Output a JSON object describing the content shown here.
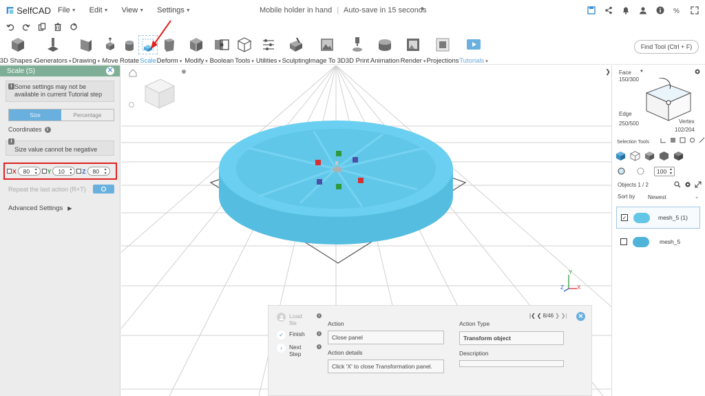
{
  "app": {
    "name": "SelfCAD"
  },
  "menu": [
    {
      "label": "File"
    },
    {
      "label": "Edit"
    },
    {
      "label": "View"
    },
    {
      "label": "Settings"
    }
  ],
  "project": {
    "title": "Mobile holder in hand",
    "autosave": "Auto-save in 15 seconds"
  },
  "toolbar": {
    "tools": [
      {
        "label": "3D Shapes",
        "has_caret": true,
        "icon": "cube-icon"
      },
      {
        "label": "Generators",
        "has_caret": true,
        "icon": "generator-icon"
      },
      {
        "label": "Drawing",
        "has_caret": true,
        "icon": "drawing-icon"
      },
      {
        "label": "Move",
        "has_caret": false,
        "icon": "move-icon"
      },
      {
        "label": "Rotate",
        "has_caret": false,
        "icon": "rotate-icon"
      },
      {
        "label": "Scale",
        "has_caret": false,
        "icon": "scale-icon",
        "active": true
      },
      {
        "label": "Deform",
        "has_caret": true,
        "icon": "deform-icon"
      },
      {
        "label": "Modify",
        "has_caret": true,
        "icon": "modify-icon"
      },
      {
        "label": "Boolean",
        "has_caret": false,
        "icon": "boolean-icon"
      },
      {
        "label": "Tools",
        "has_caret": true,
        "icon": "tools-icon"
      },
      {
        "label": "Utilities",
        "has_caret": true,
        "icon": "utilities-icon"
      },
      {
        "label": "Sculpting",
        "has_caret": false,
        "icon": "sculpting-icon"
      },
      {
        "label": "Image To 3D",
        "has_caret": false,
        "icon": "image-to-3d-icon"
      },
      {
        "label": "3D Print",
        "has_caret": false,
        "icon": "3d-print-icon"
      },
      {
        "label": "Animation",
        "has_caret": false,
        "icon": "animation-icon"
      },
      {
        "label": "Render",
        "has_caret": true,
        "icon": "render-icon"
      },
      {
        "label": "Projections",
        "has_caret": false,
        "icon": "projections-icon"
      },
      {
        "label": "Tutorials",
        "has_caret": true,
        "icon": "tutorials-icon"
      }
    ],
    "find_tool": "Find Tool (Ctrl + F)"
  },
  "left_panel": {
    "title": "Scale (S)",
    "warning": "Some settings may not be available in current Tutorial step",
    "mode_tabs": [
      "Size",
      "Percentage"
    ],
    "coordinates_label": "Coordinates",
    "size_note": "Size value cannot be negative",
    "axes": [
      {
        "label": "X",
        "value": "80",
        "color": "#d83030"
      },
      {
        "label": "Y",
        "value": "10",
        "color": "#2e9a3a"
      },
      {
        "label": "Z",
        "value": "80",
        "color": "#2b5fc7"
      }
    ],
    "repeat_label": "Repeat the last action (R+T)",
    "advanced_label": "Advanced Settings"
  },
  "right_panel": {
    "face_label": "Face",
    "face_count": "150/300",
    "edge_label": "Edge",
    "edge_count": "250/500",
    "vertex_label": "Vertex",
    "vertex_count": "102/204",
    "selection_tools_label": "Selection Tools",
    "brush_size": "100",
    "objects_label": "Objects 1 / 2",
    "sort_label": "Sort by",
    "sort_value": "Newest",
    "objects": [
      {
        "name": "mesh_5 (1)",
        "checked": true
      },
      {
        "name": "mesh_5",
        "checked": false
      }
    ]
  },
  "viewport": {
    "axes": [
      "Y",
      "Z",
      "X"
    ],
    "model_color": "#5ec3e5"
  },
  "tutorial": {
    "steps": [
      {
        "label": "Load file",
        "state": "disabled"
      },
      {
        "label": "Finish",
        "state": "done"
      },
      {
        "label": "Next Step",
        "state": "next"
      }
    ],
    "action_label": "Action",
    "action_value": "Close panel",
    "action_type_label": "Action Type",
    "action_type_value": "Transform object",
    "action_details_label": "Action details",
    "action_details_value": "Click 'X' to close Transformation panel.",
    "description_label": "Description",
    "description_value": "",
    "page": "8/46"
  }
}
